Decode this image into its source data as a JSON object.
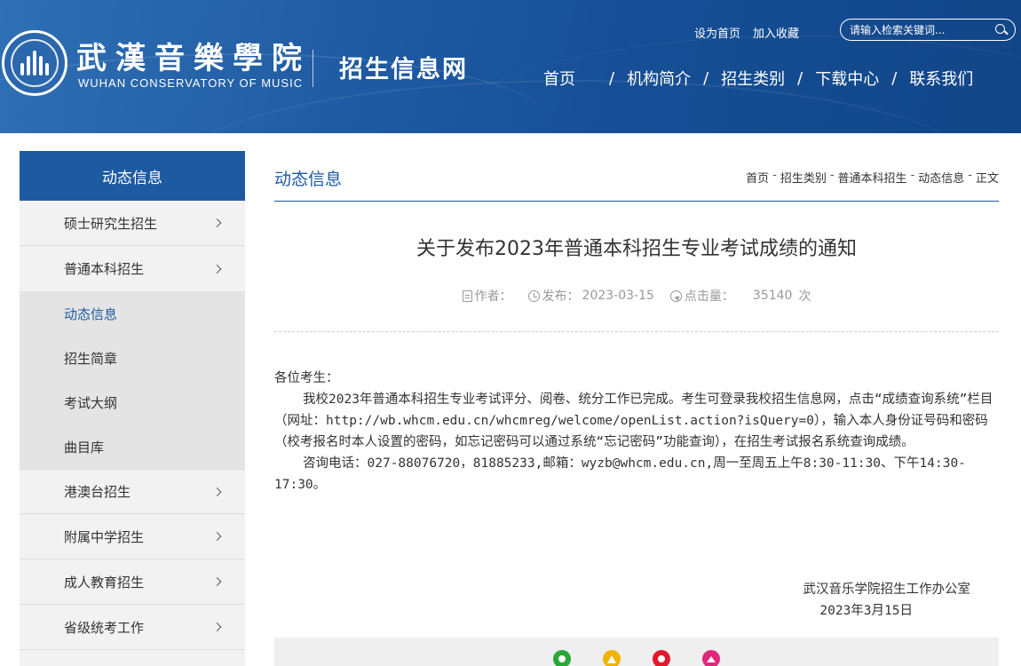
{
  "header": {
    "logo_cn": "武漢音樂學院",
    "logo_en": "WUHAN CONSERVATORY OF MUSIC",
    "site_name": "招生信息网",
    "links": {
      "set_home": "设为首页",
      "favorite": "加入收藏"
    },
    "search_placeholder": "请输入检索关键词...",
    "nav": [
      "首页",
      "机构简介",
      "招生类别",
      "下载中心",
      "联系我们"
    ],
    "nav_sep": "/",
    "colors": {
      "primary": "#1d5aa2",
      "header_dark": "#114688"
    }
  },
  "sidebar": {
    "title": "动态信息",
    "items": [
      {
        "label": "硕士研究生招生",
        "expandable": true
      },
      {
        "label": "普通本科招生",
        "expandable": true
      }
    ],
    "sub_items": [
      {
        "label": "动态信息",
        "active": true
      },
      {
        "label": "招生简章",
        "active": false
      },
      {
        "label": "考试大纲",
        "active": false
      },
      {
        "label": "曲目库",
        "active": false
      }
    ],
    "items_after": [
      {
        "label": "港澳台招生",
        "expandable": true
      },
      {
        "label": "附属中学招生",
        "expandable": true
      },
      {
        "label": "成人教育招生",
        "expandable": true
      },
      {
        "label": "省级统考工作",
        "expandable": true
      }
    ]
  },
  "content": {
    "section_title": "动态信息",
    "breadcrumb": [
      "首页",
      "招生类别",
      "普通本科招生",
      "动态信息",
      "正文"
    ],
    "breadcrumb_sep": "-",
    "article": {
      "title": "关于发布2023年普通本科招生专业考试成绩的通知",
      "meta": {
        "author_label": "作者：",
        "date_label": "发布：",
        "date": "2023-03-15",
        "clicks_label": "点击量：",
        "clicks": "35140",
        "clicks_unit": "次"
      },
      "greeting": "各位考生：",
      "paragraphs": [
        "我校2023年普通本科招生专业考试评分、阅卷、统分工作已完成。考生可登录我校招生信息网，点击“成绩查询系统”栏目（网址：http://wb.whcm.edu.cn/whcmreg/welcome/openList.action?isQuery=0），输入本人身份证号码和密码（校考报名时本人设置的密码，如忘记密码可以通过系统“忘记密码”功能查询），在招生考试报名系统查询成绩。",
        "咨询电话：027-88076720，81885233,邮箱：wyzb@whcm.edu.cn,周一至周五上午8:30-11:30、下午14:30-17:30。"
      ],
      "signature_org": "武汉音乐学院招生工作办公室",
      "signature_date": "2023年3月15日"
    },
    "share": [
      {
        "name": "wechat",
        "color": "#2aa836"
      },
      {
        "name": "qzone",
        "color": "#f0b400"
      },
      {
        "name": "weibo",
        "color": "#e6162d"
      },
      {
        "name": "more",
        "color": "#e0287a"
      }
    ]
  }
}
